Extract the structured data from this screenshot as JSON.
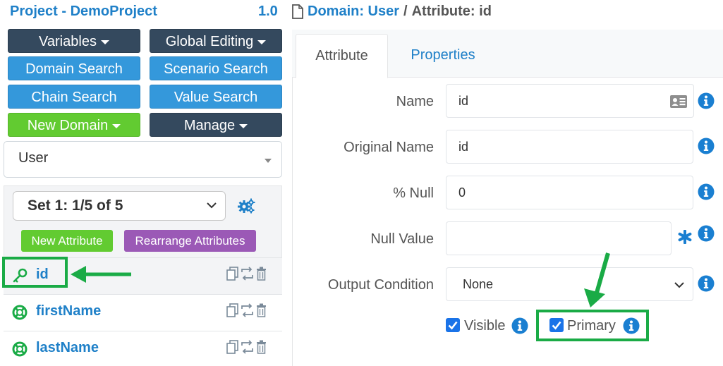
{
  "project": {
    "title": "Project - DemoProject",
    "version": "1.0"
  },
  "toolbar": {
    "variables": "Variables",
    "global_editing": "Global Editing",
    "domain_search": "Domain Search",
    "scenario_search": "Scenario Search",
    "chain_search": "Chain Search",
    "value_search": "Value Search",
    "new_domain": "New Domain",
    "manage": "Manage"
  },
  "domain_select": {
    "value": "User"
  },
  "set_select": {
    "value": "Set 1: 1/5 of 5"
  },
  "attr_buttons": {
    "new_attribute": "New Attribute",
    "rearrange": "Rearrange Attributes"
  },
  "attributes": [
    {
      "name": "id",
      "icon": "key-icon"
    },
    {
      "name": "firstName",
      "icon": "lifebuoy-icon"
    },
    {
      "name": "lastName",
      "icon": "lifebuoy-icon"
    }
  ],
  "breadcrumb": {
    "domain": "Domain: User",
    "separator": "/",
    "attribute": "Attribute: id"
  },
  "tabs": {
    "attribute": "Attribute",
    "properties": "Properties"
  },
  "form": {
    "name": {
      "label": "Name",
      "value": "id"
    },
    "original_name": {
      "label": "Original Name",
      "value": "id"
    },
    "pct_null": {
      "label": "% Null",
      "value": "0"
    },
    "null_value": {
      "label": "Null Value",
      "value": ""
    },
    "output_condition": {
      "label": "Output Condition",
      "value": "None"
    },
    "visible": {
      "label": "Visible",
      "checked": true
    },
    "primary": {
      "label": "Primary",
      "checked": true
    }
  },
  "colors": {
    "brand_blue": "#1f80c8",
    "dark_button": "#34495e",
    "blue_button": "#3498db",
    "green_button": "#62cb31",
    "purple_button": "#9b59b6",
    "annotation_green": "#1aab46",
    "required_asterisk": "#1a7fd1"
  }
}
